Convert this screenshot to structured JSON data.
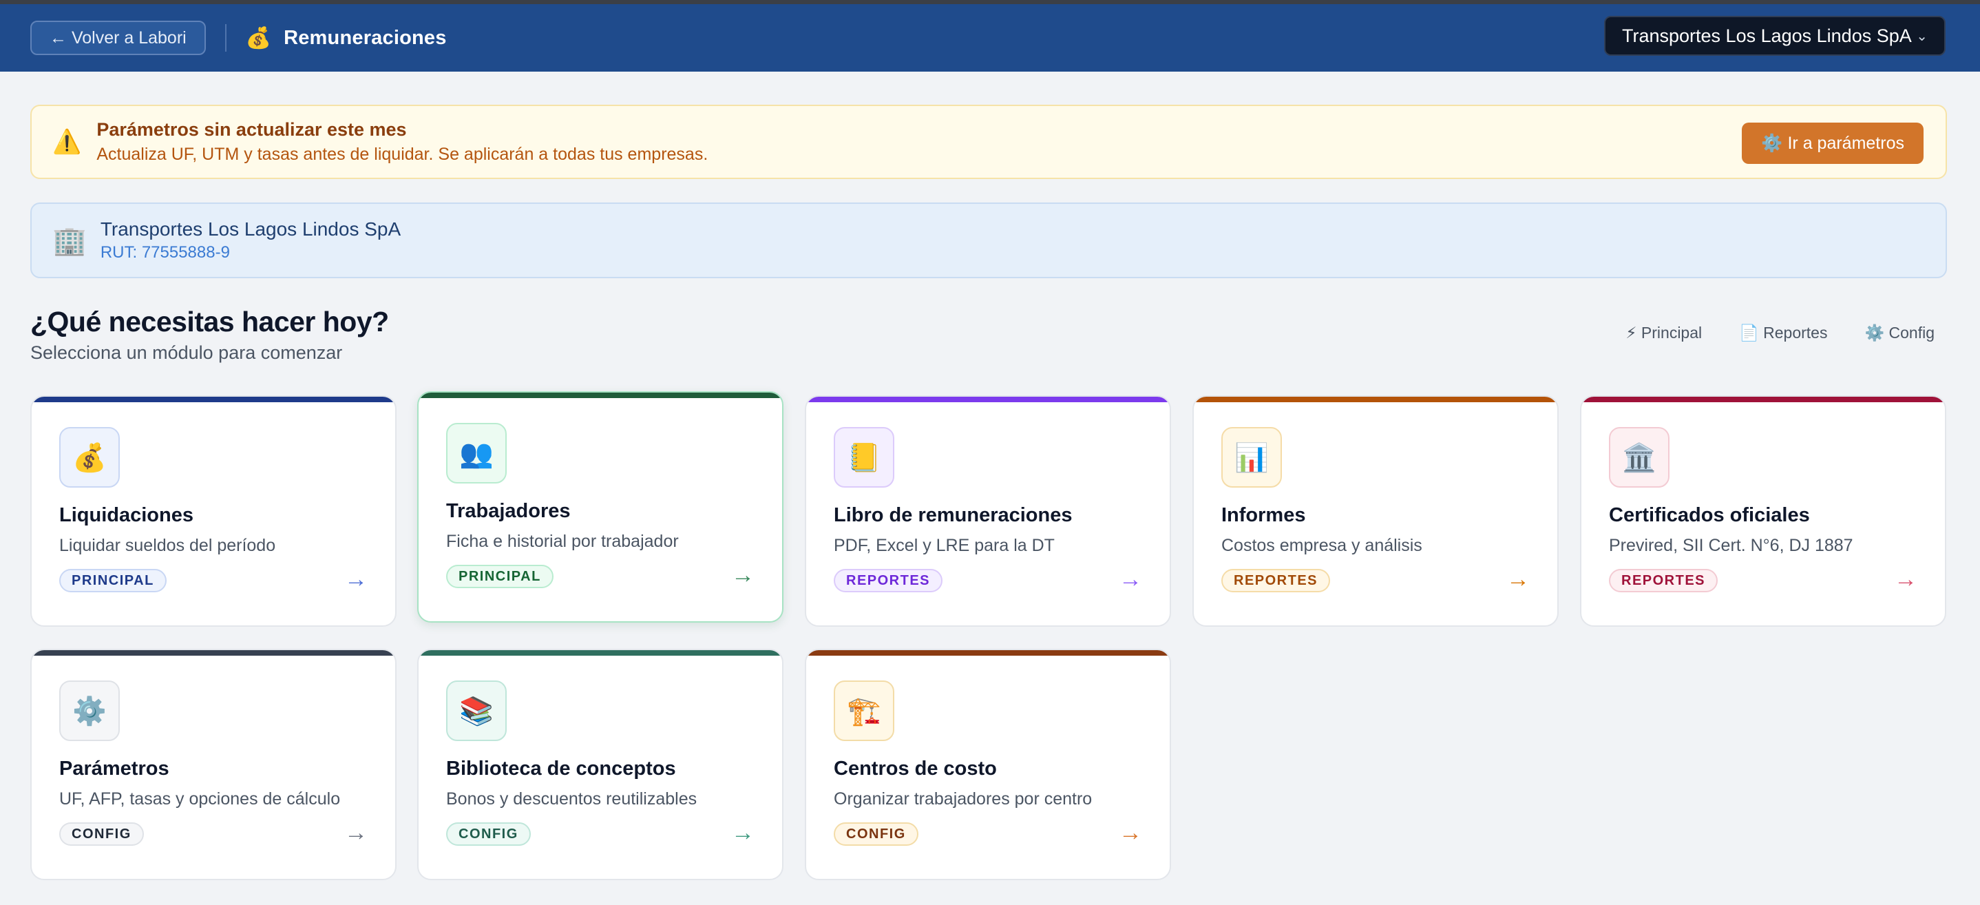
{
  "header": {
    "back_label": "← Volver a Labori",
    "app_icon": "money-bag-icon",
    "app_icon_glyph": "💰",
    "app_title": "Remuneraciones",
    "company_selected": "Transportes Los Lagos Lindos SpA",
    "chevron": "⌄"
  },
  "alert": {
    "icon_glyph": "⚠️",
    "title": "Parámetros sin actualizar este mes",
    "text": "Actualiza UF, UTM y tasas antes de liquidar. Se aplicarán a todas tus empresas.",
    "button_label": "⚙️ Ir a parámetros"
  },
  "company": {
    "icon_glyph": "🏢",
    "name": "Transportes Los Lagos Lindos SpA",
    "rut": "RUT: 77555888-9"
  },
  "main": {
    "heading": "¿Qué necesitas hacer hoy?",
    "subheading": "Selecciona un módulo para comenzar",
    "filters": [
      {
        "label": "⚡ Principal"
      },
      {
        "label": "📄 Reportes"
      },
      {
        "label": "⚙️ Config"
      }
    ]
  },
  "modules": [
    {
      "title": "Liquidaciones",
      "desc": "Liquidar sueldos del período",
      "tag": "PRINCIPAL",
      "icon": "💰",
      "icon_name": "money-bag-icon",
      "arrow": "→",
      "accent": "#1e3a8a",
      "tag_color": "#1e3a8a",
      "tag_bg": "#eef3fd",
      "tag_border": "#c9d7f4",
      "icon_bg": "#eef3fd",
      "icon_border": "#c9d7f4",
      "arrow_color": "#4f6fd6"
    },
    {
      "title": "Trabajadores",
      "desc": "Ficha e historial por trabajador",
      "tag": "PRINCIPAL",
      "icon": "👥",
      "icon_name": "people-icon",
      "arrow": "→",
      "accent": "#1f5c3a",
      "tag_color": "#166534",
      "tag_bg": "#ecfbf2",
      "tag_border": "#b9ecd0",
      "icon_bg": "#ecfbf2",
      "icon_border": "#b9ecd0",
      "arrow_color": "#3b8a5e"
    },
    {
      "title": "Libro de remuneraciones",
      "desc": "PDF, Excel y LRE para la DT",
      "tag": "REPORTES",
      "icon": "📒",
      "icon_name": "ledger-icon",
      "arrow": "→",
      "accent": "#7c3aed",
      "tag_color": "#6d28d9",
      "tag_bg": "#f4efff",
      "tag_border": "#dccbfb",
      "icon_bg": "#f4efff",
      "icon_border": "#dccbfb",
      "arrow_color": "#8b5cf6"
    },
    {
      "title": "Informes",
      "desc": "Costos empresa y análisis",
      "tag": "REPORTES",
      "icon": "📊",
      "icon_name": "bar-chart-icon",
      "arrow": "→",
      "accent": "#b45309",
      "tag_color": "#a14a08",
      "tag_bg": "#fff7e6",
      "tag_border": "#f5dca8",
      "icon_bg": "#fff8e6",
      "icon_border": "#f5dca8",
      "arrow_color": "#d97706"
    },
    {
      "title": "Certificados oficiales",
      "desc": "Previred, SII Cert. N°6, DJ 1887",
      "tag": "REPORTES",
      "icon": "🏛️",
      "icon_name": "institution-icon",
      "arrow": "→",
      "accent": "#9f1239",
      "tag_color": "#9f1239",
      "tag_bg": "#fdf0f2",
      "tag_border": "#f3cbd3",
      "icon_bg": "#fdf0f2",
      "icon_border": "#f3cbd3",
      "arrow_color": "#d9536f"
    },
    {
      "title": "Parámetros",
      "desc": "UF, AFP, tasas y opciones de cálculo",
      "tag": "CONFIG",
      "icon": "⚙️",
      "icon_name": "gear-icon",
      "arrow": "→",
      "accent": "#374151",
      "tag_color": "#1f2937",
      "tag_bg": "#f5f6f8",
      "tag_border": "#dfe2e7",
      "icon_bg": "#f5f6f8",
      "icon_border": "#dfe2e7",
      "arrow_color": "#6b7280"
    },
    {
      "title": "Biblioteca de conceptos",
      "desc": "Bonos y descuentos reutilizables",
      "tag": "CONFIG",
      "icon": "📚",
      "icon_name": "books-icon",
      "arrow": "→",
      "accent": "#2f6f5f",
      "tag_color": "#1f5c4c",
      "tag_bg": "#edf9f5",
      "tag_border": "#bfe6da",
      "icon_bg": "#edf9f5",
      "icon_border": "#bfe6da",
      "arrow_color": "#3f9a80"
    },
    {
      "title": "Centros de costo",
      "desc": "Organizar trabajadores por centro",
      "tag": "CONFIG",
      "icon": "🏗️",
      "icon_name": "crane-icon",
      "arrow": "→",
      "accent": "#8a3b12",
      "tag_color": "#7a3410",
      "tag_bg": "#fff6e5",
      "tag_border": "#f3dca8",
      "icon_bg": "#fff8e6",
      "icon_border": "#f3dca8",
      "arrow_color": "#d9752a"
    }
  ]
}
